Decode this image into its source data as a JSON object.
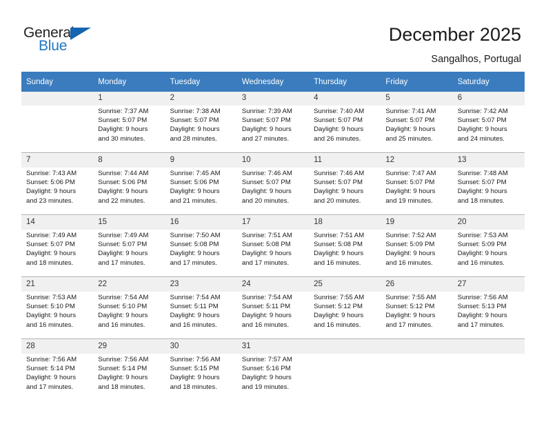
{
  "brand": {
    "name_part1": "General",
    "name_part2": "Blue",
    "triangle_color": "#1565b0",
    "blue_color": "#1f76c4"
  },
  "header": {
    "title": "December 2025",
    "location": "Sangalhos, Portugal",
    "header_bg": "#3a7cbe"
  },
  "calendar": {
    "weekday_headers": [
      "Sunday",
      "Monday",
      "Tuesday",
      "Wednesday",
      "Thursday",
      "Friday",
      "Saturday"
    ],
    "weeks": [
      [
        {
          "day": "",
          "sunrise": "",
          "sunset": "",
          "daylight_line1": "",
          "daylight_line2": ""
        },
        {
          "day": "1",
          "sunrise": "Sunrise: 7:37 AM",
          "sunset": "Sunset: 5:07 PM",
          "daylight_line1": "Daylight: 9 hours",
          "daylight_line2": "and 30 minutes."
        },
        {
          "day": "2",
          "sunrise": "Sunrise: 7:38 AM",
          "sunset": "Sunset: 5:07 PM",
          "daylight_line1": "Daylight: 9 hours",
          "daylight_line2": "and 28 minutes."
        },
        {
          "day": "3",
          "sunrise": "Sunrise: 7:39 AM",
          "sunset": "Sunset: 5:07 PM",
          "daylight_line1": "Daylight: 9 hours",
          "daylight_line2": "and 27 minutes."
        },
        {
          "day": "4",
          "sunrise": "Sunrise: 7:40 AM",
          "sunset": "Sunset: 5:07 PM",
          "daylight_line1": "Daylight: 9 hours",
          "daylight_line2": "and 26 minutes."
        },
        {
          "day": "5",
          "sunrise": "Sunrise: 7:41 AM",
          "sunset": "Sunset: 5:07 PM",
          "daylight_line1": "Daylight: 9 hours",
          "daylight_line2": "and 25 minutes."
        },
        {
          "day": "6",
          "sunrise": "Sunrise: 7:42 AM",
          "sunset": "Sunset: 5:07 PM",
          "daylight_line1": "Daylight: 9 hours",
          "daylight_line2": "and 24 minutes."
        }
      ],
      [
        {
          "day": "7",
          "sunrise": "Sunrise: 7:43 AM",
          "sunset": "Sunset: 5:06 PM",
          "daylight_line1": "Daylight: 9 hours",
          "daylight_line2": "and 23 minutes."
        },
        {
          "day": "8",
          "sunrise": "Sunrise: 7:44 AM",
          "sunset": "Sunset: 5:06 PM",
          "daylight_line1": "Daylight: 9 hours",
          "daylight_line2": "and 22 minutes."
        },
        {
          "day": "9",
          "sunrise": "Sunrise: 7:45 AM",
          "sunset": "Sunset: 5:06 PM",
          "daylight_line1": "Daylight: 9 hours",
          "daylight_line2": "and 21 minutes."
        },
        {
          "day": "10",
          "sunrise": "Sunrise: 7:46 AM",
          "sunset": "Sunset: 5:07 PM",
          "daylight_line1": "Daylight: 9 hours",
          "daylight_line2": "and 20 minutes."
        },
        {
          "day": "11",
          "sunrise": "Sunrise: 7:46 AM",
          "sunset": "Sunset: 5:07 PM",
          "daylight_line1": "Daylight: 9 hours",
          "daylight_line2": "and 20 minutes."
        },
        {
          "day": "12",
          "sunrise": "Sunrise: 7:47 AM",
          "sunset": "Sunset: 5:07 PM",
          "daylight_line1": "Daylight: 9 hours",
          "daylight_line2": "and 19 minutes."
        },
        {
          "day": "13",
          "sunrise": "Sunrise: 7:48 AM",
          "sunset": "Sunset: 5:07 PM",
          "daylight_line1": "Daylight: 9 hours",
          "daylight_line2": "and 18 minutes."
        }
      ],
      [
        {
          "day": "14",
          "sunrise": "Sunrise: 7:49 AM",
          "sunset": "Sunset: 5:07 PM",
          "daylight_line1": "Daylight: 9 hours",
          "daylight_line2": "and 18 minutes."
        },
        {
          "day": "15",
          "sunrise": "Sunrise: 7:49 AM",
          "sunset": "Sunset: 5:07 PM",
          "daylight_line1": "Daylight: 9 hours",
          "daylight_line2": "and 17 minutes."
        },
        {
          "day": "16",
          "sunrise": "Sunrise: 7:50 AM",
          "sunset": "Sunset: 5:08 PM",
          "daylight_line1": "Daylight: 9 hours",
          "daylight_line2": "and 17 minutes."
        },
        {
          "day": "17",
          "sunrise": "Sunrise: 7:51 AM",
          "sunset": "Sunset: 5:08 PM",
          "daylight_line1": "Daylight: 9 hours",
          "daylight_line2": "and 17 minutes."
        },
        {
          "day": "18",
          "sunrise": "Sunrise: 7:51 AM",
          "sunset": "Sunset: 5:08 PM",
          "daylight_line1": "Daylight: 9 hours",
          "daylight_line2": "and 16 minutes."
        },
        {
          "day": "19",
          "sunrise": "Sunrise: 7:52 AM",
          "sunset": "Sunset: 5:09 PM",
          "daylight_line1": "Daylight: 9 hours",
          "daylight_line2": "and 16 minutes."
        },
        {
          "day": "20",
          "sunrise": "Sunrise: 7:53 AM",
          "sunset": "Sunset: 5:09 PM",
          "daylight_line1": "Daylight: 9 hours",
          "daylight_line2": "and 16 minutes."
        }
      ],
      [
        {
          "day": "21",
          "sunrise": "Sunrise: 7:53 AM",
          "sunset": "Sunset: 5:10 PM",
          "daylight_line1": "Daylight: 9 hours",
          "daylight_line2": "and 16 minutes."
        },
        {
          "day": "22",
          "sunrise": "Sunrise: 7:54 AM",
          "sunset": "Sunset: 5:10 PM",
          "daylight_line1": "Daylight: 9 hours",
          "daylight_line2": "and 16 minutes."
        },
        {
          "day": "23",
          "sunrise": "Sunrise: 7:54 AM",
          "sunset": "Sunset: 5:11 PM",
          "daylight_line1": "Daylight: 9 hours",
          "daylight_line2": "and 16 minutes."
        },
        {
          "day": "24",
          "sunrise": "Sunrise: 7:54 AM",
          "sunset": "Sunset: 5:11 PM",
          "daylight_line1": "Daylight: 9 hours",
          "daylight_line2": "and 16 minutes."
        },
        {
          "day": "25",
          "sunrise": "Sunrise: 7:55 AM",
          "sunset": "Sunset: 5:12 PM",
          "daylight_line1": "Daylight: 9 hours",
          "daylight_line2": "and 16 minutes."
        },
        {
          "day": "26",
          "sunrise": "Sunrise: 7:55 AM",
          "sunset": "Sunset: 5:12 PM",
          "daylight_line1": "Daylight: 9 hours",
          "daylight_line2": "and 17 minutes."
        },
        {
          "day": "27",
          "sunrise": "Sunrise: 7:56 AM",
          "sunset": "Sunset: 5:13 PM",
          "daylight_line1": "Daylight: 9 hours",
          "daylight_line2": "and 17 minutes."
        }
      ],
      [
        {
          "day": "28",
          "sunrise": "Sunrise: 7:56 AM",
          "sunset": "Sunset: 5:14 PM",
          "daylight_line1": "Daylight: 9 hours",
          "daylight_line2": "and 17 minutes."
        },
        {
          "day": "29",
          "sunrise": "Sunrise: 7:56 AM",
          "sunset": "Sunset: 5:14 PM",
          "daylight_line1": "Daylight: 9 hours",
          "daylight_line2": "and 18 minutes."
        },
        {
          "day": "30",
          "sunrise": "Sunrise: 7:56 AM",
          "sunset": "Sunset: 5:15 PM",
          "daylight_line1": "Daylight: 9 hours",
          "daylight_line2": "and 18 minutes."
        },
        {
          "day": "31",
          "sunrise": "Sunrise: 7:57 AM",
          "sunset": "Sunset: 5:16 PM",
          "daylight_line1": "Daylight: 9 hours",
          "daylight_line2": "and 19 minutes."
        },
        {
          "day": "",
          "sunrise": "",
          "sunset": "",
          "daylight_line1": "",
          "daylight_line2": ""
        },
        {
          "day": "",
          "sunrise": "",
          "sunset": "",
          "daylight_line1": "",
          "daylight_line2": ""
        },
        {
          "day": "",
          "sunrise": "",
          "sunset": "",
          "daylight_line1": "",
          "daylight_line2": ""
        }
      ]
    ]
  }
}
